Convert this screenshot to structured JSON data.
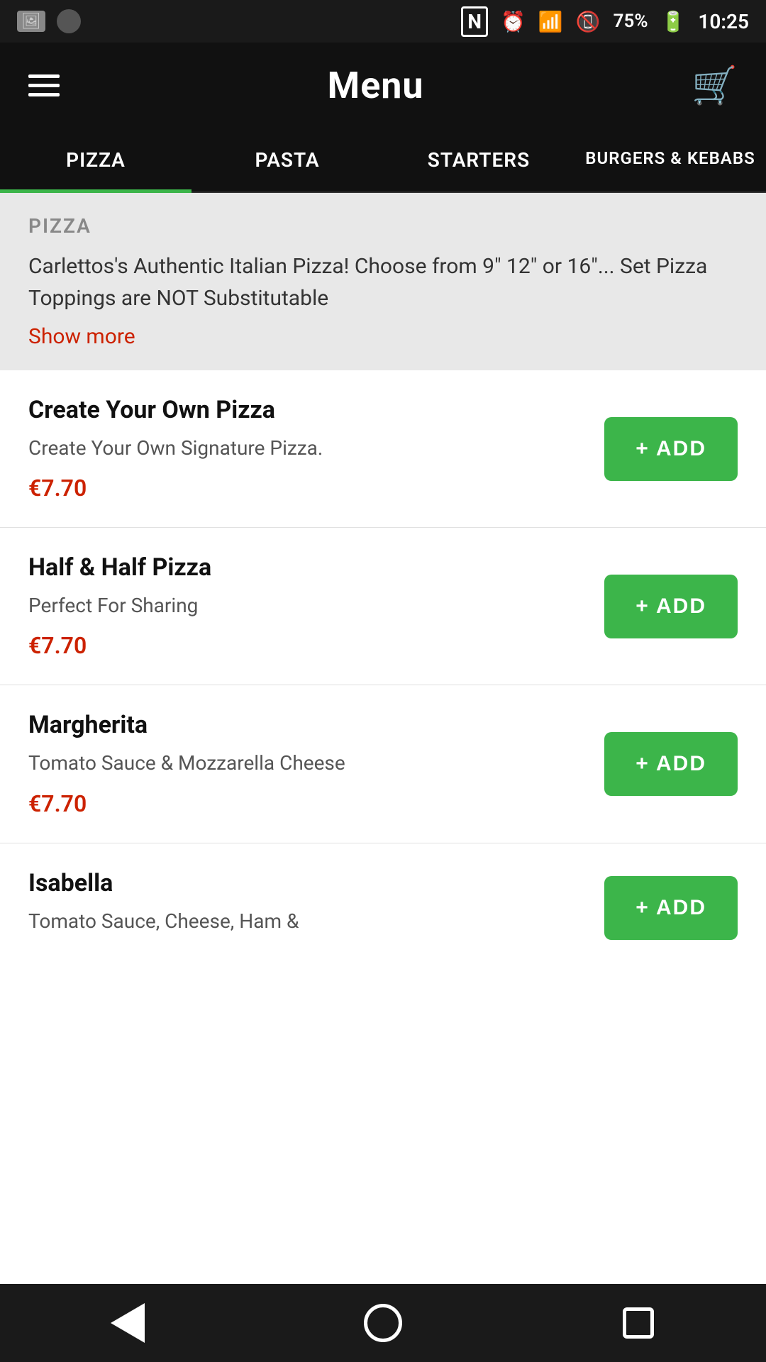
{
  "status_bar": {
    "battery": "75%",
    "time": "10:25",
    "icons": [
      "photo",
      "circle",
      "nfc",
      "alarm",
      "wifi",
      "sim",
      "battery"
    ]
  },
  "header": {
    "title": "Menu",
    "hamburger_label": "Menu navigation",
    "cart_label": "Cart"
  },
  "tabs": [
    {
      "id": "pizza",
      "label": "PIZZA",
      "active": true
    },
    {
      "id": "pasta",
      "label": "PASTA",
      "active": false
    },
    {
      "id": "starters",
      "label": "STARTERS",
      "active": false
    },
    {
      "id": "burgers",
      "label": "BURGERS & KEBABS",
      "active": false
    }
  ],
  "section": {
    "title": "PIZZA",
    "description": "Carlettos's Authentic Italian Pizza! Choose from 9\" 12\" or 16\"... Set Pizza Toppings are NOT Substitutable",
    "show_more_label": "Show more"
  },
  "menu_items": [
    {
      "name": "Create Your Own Pizza",
      "description": "Create Your Own Signature Pizza.",
      "price": "€7.70",
      "add_label": "+ ADD"
    },
    {
      "name": "Half & Half Pizza",
      "description": "Perfect For Sharing",
      "price": "€7.70",
      "add_label": "+ ADD"
    },
    {
      "name": "Margherita",
      "description": "Tomato Sauce & Mozzarella Cheese",
      "price": "€7.70",
      "add_label": "+ ADD"
    },
    {
      "name": "Isabella",
      "description": "Tomato Sauce, Cheese, Ham &",
      "price": "",
      "add_label": "+ ADD"
    }
  ],
  "colors": {
    "accent_green": "#3cb54a",
    "accent_red": "#cc2200",
    "bg_dark": "#111111",
    "bg_light": "#e8e8e8"
  },
  "bottom_nav": {
    "back_label": "Back",
    "home_label": "Home",
    "recent_label": "Recent"
  }
}
